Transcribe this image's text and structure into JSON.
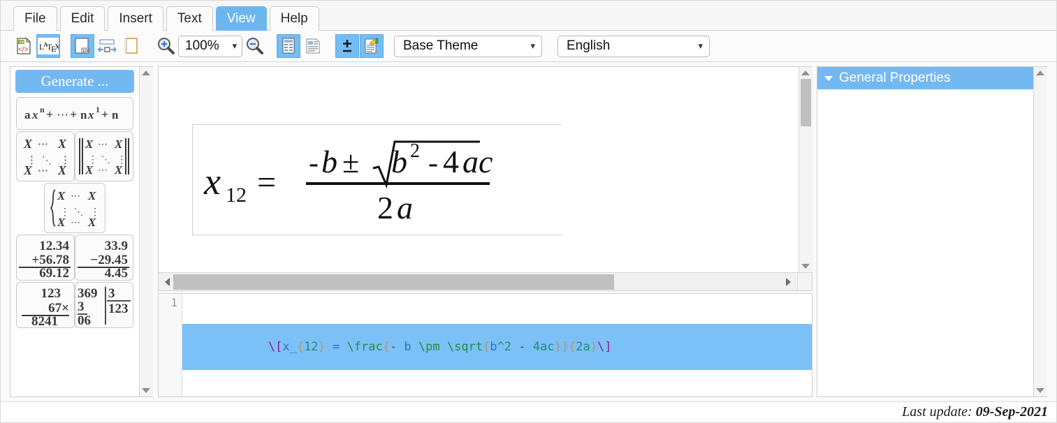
{
  "app": {
    "menu_tabs": [
      {
        "label": "File",
        "active": false
      },
      {
        "label": "Edit",
        "active": false
      },
      {
        "label": "Insert",
        "active": false
      },
      {
        "label": "Text",
        "active": false
      },
      {
        "label": "View",
        "active": true
      },
      {
        "label": "Help",
        "active": false
      }
    ]
  },
  "toolbar": {
    "buttons": [
      {
        "name": "export-xml-icon",
        "title": "Export XML/HTML",
        "active": false
      },
      {
        "name": "latex-icon",
        "title": "LaTeX",
        "active": true
      },
      {
        "name": "page-size-100-icon",
        "title": "Actual size",
        "active": true
      },
      {
        "name": "fit-width-icon",
        "title": "Fit width",
        "active": false
      },
      {
        "name": "page-icon",
        "title": "Page",
        "active": false
      },
      {
        "name": "zoom-in-icon",
        "title": "Zoom in",
        "active": false
      },
      {
        "name": "zoom-out-icon",
        "title": "Zoom out",
        "active": false
      },
      {
        "name": "show-grid-icon",
        "title": "Show grid",
        "active": true
      },
      {
        "name": "show-article-icon",
        "title": "Show article",
        "active": false
      },
      {
        "name": "plus-minus-icon",
        "title": "Plus minus",
        "active": true
      },
      {
        "name": "annotate-icon",
        "title": "Annotate",
        "active": true
      }
    ],
    "zoom": {
      "value": "100%",
      "chevron": "chevron-down-icon"
    },
    "theme": {
      "value": "Base Theme",
      "chevron": "chevron-down-icon"
    },
    "language": {
      "value": "English",
      "chevron": "chevron-down-icon"
    }
  },
  "sidebar": {
    "generate_label": "Generate ...",
    "templates": [
      {
        "name": "polynomial-template",
        "kind": "wide",
        "label": "a x^n + ... + n x^1 + n"
      },
      {
        "name": "matrix-template",
        "kind": "matrix",
        "label": "X ... X matrix"
      },
      {
        "name": "determinant-template",
        "kind": "determinant",
        "label": "|| X ... X || determinant"
      },
      {
        "name": "cases-matrix-template",
        "kind": "cases",
        "label": "{ X ... X braced matrix"
      },
      {
        "name": "addition-template",
        "kind": "arith",
        "a": "12.34",
        "b": "+56.78",
        "result": "69.12"
      },
      {
        "name": "subtraction-template",
        "kind": "arith",
        "a": "33.9",
        "b": "−29.45",
        "result": "4.45"
      },
      {
        "name": "multiplication-template",
        "kind": "arith",
        "a": "123",
        "b": "67×",
        "result": "8241"
      },
      {
        "name": "division-template",
        "kind": "division",
        "dividend": "369",
        "divisor": "3",
        "step": "3",
        "remainder": "06",
        "quotient": "123"
      }
    ]
  },
  "preview": {
    "formula": {
      "lhs_base": "x",
      "lhs_sub": "12",
      "equals": "=",
      "numerator": "-b ± √(b² - 4ac)",
      "denominator": "2a",
      "num_minus": "-",
      "num_b": "b",
      "num_pm": "±",
      "num_radicand_b": "b",
      "num_radicand_exp": "2",
      "num_radicand_rest": "- 4ac"
    },
    "hscroll": {
      "thumb_pct": 72
    },
    "vscroll": {
      "thumb_pct": 26
    }
  },
  "editor": {
    "line_number": "1",
    "tokens": [
      {
        "t": "\\\\[",
        "c": "tk-delim"
      },
      {
        "t": "x",
        "c": "tk-var"
      },
      {
        "t": "_",
        "c": "tk-op"
      },
      {
        "t": "{",
        "c": "tk-brace"
      },
      {
        "t": "12",
        "c": "tk-num"
      },
      {
        "t": "}",
        "c": "tk-brace"
      },
      {
        "t": " = ",
        "c": "tk-op"
      },
      {
        "t": "\\\\frac",
        "c": "tk-cmd"
      },
      {
        "t": "{",
        "c": "tk-brace"
      },
      {
        "t": "- ",
        "c": "tk-minus"
      },
      {
        "t": "b ",
        "c": "tk-var"
      },
      {
        "t": "\\\\pm ",
        "c": "tk-cmd"
      },
      {
        "t": "\\\\sqrt",
        "c": "tk-cmd"
      },
      {
        "t": "{",
        "c": "tk-brace"
      },
      {
        "t": "b",
        "c": "tk-var"
      },
      {
        "t": "^2 ",
        "c": "tk-num"
      },
      {
        "t": "- ",
        "c": "tk-minus"
      },
      {
        "t": "4ac",
        "c": "tk-num"
      },
      {
        "t": "}",
        "c": "tk-brace"
      },
      {
        "t": "}",
        "c": "tk-brace"
      },
      {
        "t": "{",
        "c": "tk-brace"
      },
      {
        "t": "2a",
        "c": "tk-num"
      },
      {
        "t": "}",
        "c": "tk-brace"
      },
      {
        "t": "\\\\]",
        "c": "tk-delim"
      }
    ],
    "plain_source": "\\[x_{12} = \\frac{- b \\pm \\sqrt{b^2 - 4ac}}{2a}\\]"
  },
  "properties": {
    "header": "General Properties",
    "twisty": "triangle-down-icon"
  },
  "status": {
    "label": "Last update:",
    "date": "09-Sep-2021"
  },
  "colors": {
    "accent": "#74b8f2",
    "accent_tab": "#6cb6f0",
    "code_selection": "#7cc0f8",
    "panel_border": "#cfcfcf",
    "scrollbar_thumb": "#bfbfbf"
  }
}
